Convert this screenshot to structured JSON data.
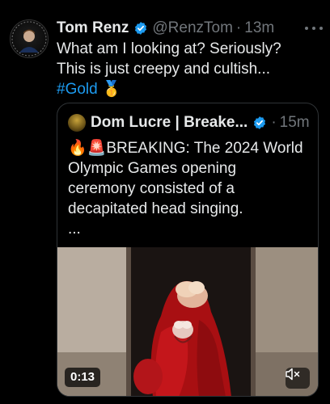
{
  "post": {
    "author_name": "Tom Renz",
    "author_handle": "@RenzTom",
    "time": "13m",
    "text_line1": "What am I looking at? Seriously?",
    "text_line2": "This is just creepy and cultish...",
    "hashtag": "#Gold",
    "hashtag_emoji": "🥇",
    "avatar_text": "TOM RENZ SHOW"
  },
  "quoted": {
    "author_name": "Dom Lucre | Breake...",
    "time": "15m",
    "emoji_prefix": "🔥🚨",
    "text_line1": "BREAKING: The 2024 World",
    "text_line2": "Olympic Games opening",
    "text_line3": "ceremony consisted of a",
    "text_line4": "decapitated head singing.",
    "text_line5": "...",
    "video_duration": "0:13"
  },
  "colors": {
    "background": "#000000",
    "text": "#e7e9ea",
    "secondary": "#71767b",
    "link": "#1d9bf0",
    "verified": "#1d9bf0"
  }
}
